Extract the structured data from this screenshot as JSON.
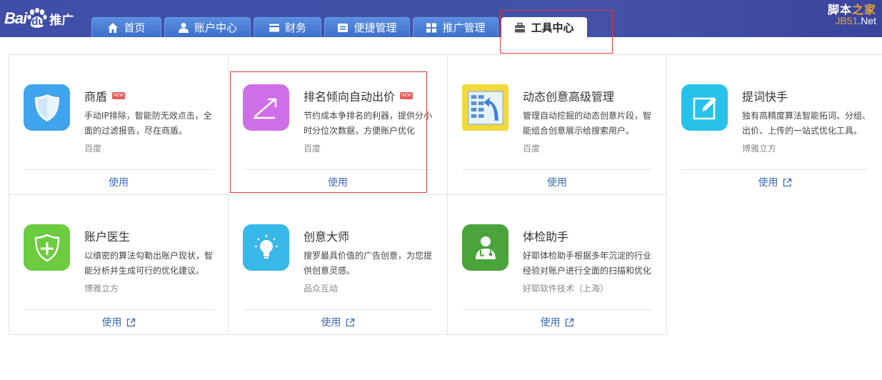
{
  "header": {
    "logo": {
      "bai": "Bai",
      "du": "du",
      "tuiguang": "推广"
    },
    "tabs": [
      {
        "label": "首页",
        "icon": "home-icon"
      },
      {
        "label": "账户中心",
        "icon": "user-icon"
      },
      {
        "label": "财务",
        "icon": "card-icon"
      },
      {
        "label": "便捷管理",
        "icon": "list-box-icon"
      },
      {
        "label": "推广管理",
        "icon": "grid-icon"
      },
      {
        "label": "工具中心",
        "icon": "toolbox-icon",
        "active": true
      }
    ],
    "brand": {
      "top_a": "脚本",
      "top_b": "之家",
      "bottom_a": "JB51",
      "bottom_b": ".Net"
    }
  },
  "tools": [
    {
      "title": "商盾",
      "new": true,
      "desc": "手动IP排除，智能防无效点击，全面的过滤报告，尽在商盾。",
      "vendor": "百度",
      "use": "使用",
      "external": false,
      "icon": "shield-icon",
      "color": "#3fa3ee"
    },
    {
      "title": "排名倾向自动出价",
      "new": true,
      "desc": "节约成本争排名的利器，提供分小时分位次数据，方便账户优化",
      "vendor": "百度",
      "use": "使用",
      "external": false,
      "icon": "trend-arrow-icon",
      "color": "#cf6fe8"
    },
    {
      "title": "动态创意高级管理",
      "new": false,
      "desc": "管理自动挖掘的动态创意片段，智能组合创意展示给搜索用户。",
      "vendor": "百度",
      "use": "使用",
      "external": false,
      "icon": "dynamic-creative-icon",
      "color": "#f3d83b"
    },
    {
      "title": "提词快手",
      "new": false,
      "desc": "独有高精度算法智能拓词、分组、出价、上传的一站式优化工具。",
      "vendor": "博雅立方",
      "use": "使用",
      "external": true,
      "icon": "edit-icon",
      "color": "#27c2ea"
    },
    {
      "title": "账户医生",
      "new": false,
      "desc": "以缜密的算法勾勒出账户现状，智能分析并生成可行的优化建议。",
      "vendor": "博雅立方",
      "use": "使用",
      "external": true,
      "icon": "medical-shield-icon",
      "color": "#6ccc3f"
    },
    {
      "title": "创意大师",
      "new": false,
      "desc": "搜罗最具价值的广告创意，为您提供创意灵感。",
      "vendor": "品众互动",
      "use": "使用",
      "external": true,
      "icon": "lightbulb-icon",
      "color": "#38b8e8"
    },
    {
      "title": "体检助手",
      "new": false,
      "desc": "好耶体检助手根据多年沉淀的行业经验对账户进行全面的扫描和优化",
      "vendor": "好耶软件技术（上海）",
      "use": "使用",
      "external": true,
      "icon": "doctor-icon",
      "color": "#4aa33b"
    }
  ],
  "new_badge": "NEW",
  "colors": {
    "header": "#4352a8",
    "tab": "#4a7fd6",
    "link": "#3d6bb5",
    "highlight": "#e23b3b"
  }
}
